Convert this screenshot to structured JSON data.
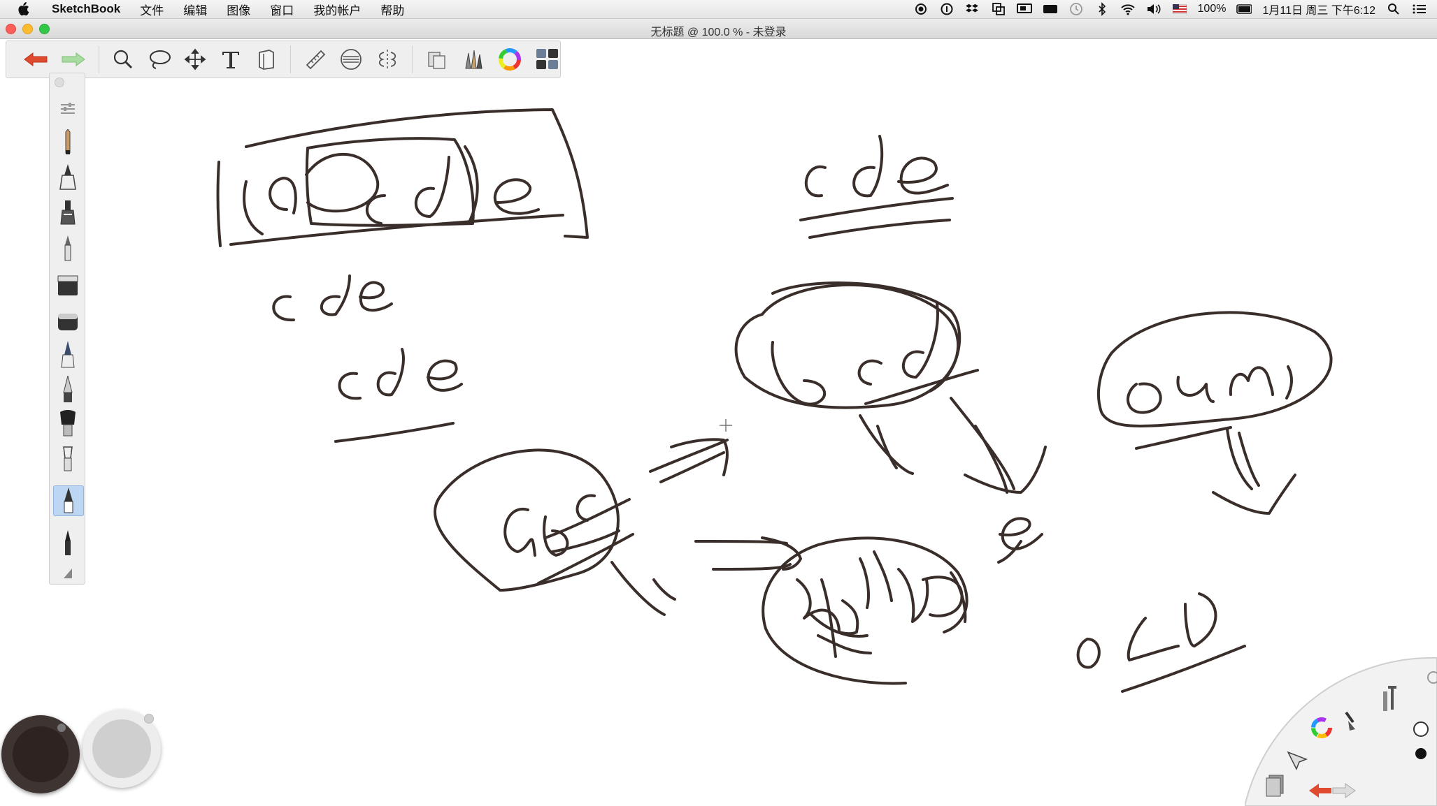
{
  "menubar": {
    "app_name": "SketchBook",
    "menus": [
      "文件",
      "编辑",
      "图像",
      "窗口",
      "我的帐户",
      "帮助"
    ],
    "status": {
      "battery": "100%",
      "datetime": "1月11日 周三 下午6:12"
    }
  },
  "window": {
    "title": "无标题 @ 100.0 % - 未登录"
  },
  "colors": {
    "ink": "#3a2e2b",
    "primary_color": "#2e2320",
    "secondary_color": "#cfcfcf",
    "active_brush_highlight": "#bcd6f3"
  },
  "toolbar": {
    "tools": [
      "undo-icon",
      "redo-icon",
      "zoom-icon",
      "lasso-icon",
      "move-icon",
      "text-icon",
      "layer-icon",
      "ruler-icon",
      "ellipse-guide-icon",
      "symmetry-icon",
      "copy-paste-icon",
      "brushes-icon",
      "color-wheel-icon",
      "palette-icon"
    ]
  },
  "brush_palette": {
    "brushes": [
      "pencil",
      "inking-pen",
      "marker",
      "ballpoint",
      "flat-eraser",
      "soft-eraser",
      "airbrush",
      "paintbrush",
      "smudge-brush",
      "blender",
      "chisel-pen",
      "felt-pen",
      "wedge"
    ],
    "active_brush": "chisel-pen"
  },
  "canvas": {
    "description_strokes": "handwritten sketch",
    "handwriting": {
      "box_word": "abcde",
      "top_right_word": "cde",
      "left_word_1": "cde",
      "left_word_2": "cde",
      "circle_center": "bcd",
      "circle_right": "oumi",
      "circle_left": "abc",
      "loose_letter": "e",
      "bottom_right_word": "oLD"
    }
  },
  "lagoon": {
    "items": [
      "brush-icon",
      "tools-icon",
      "color-wheel-icon",
      "select-icon",
      "layers-icon",
      "undo-icon",
      "redo-icon"
    ]
  }
}
